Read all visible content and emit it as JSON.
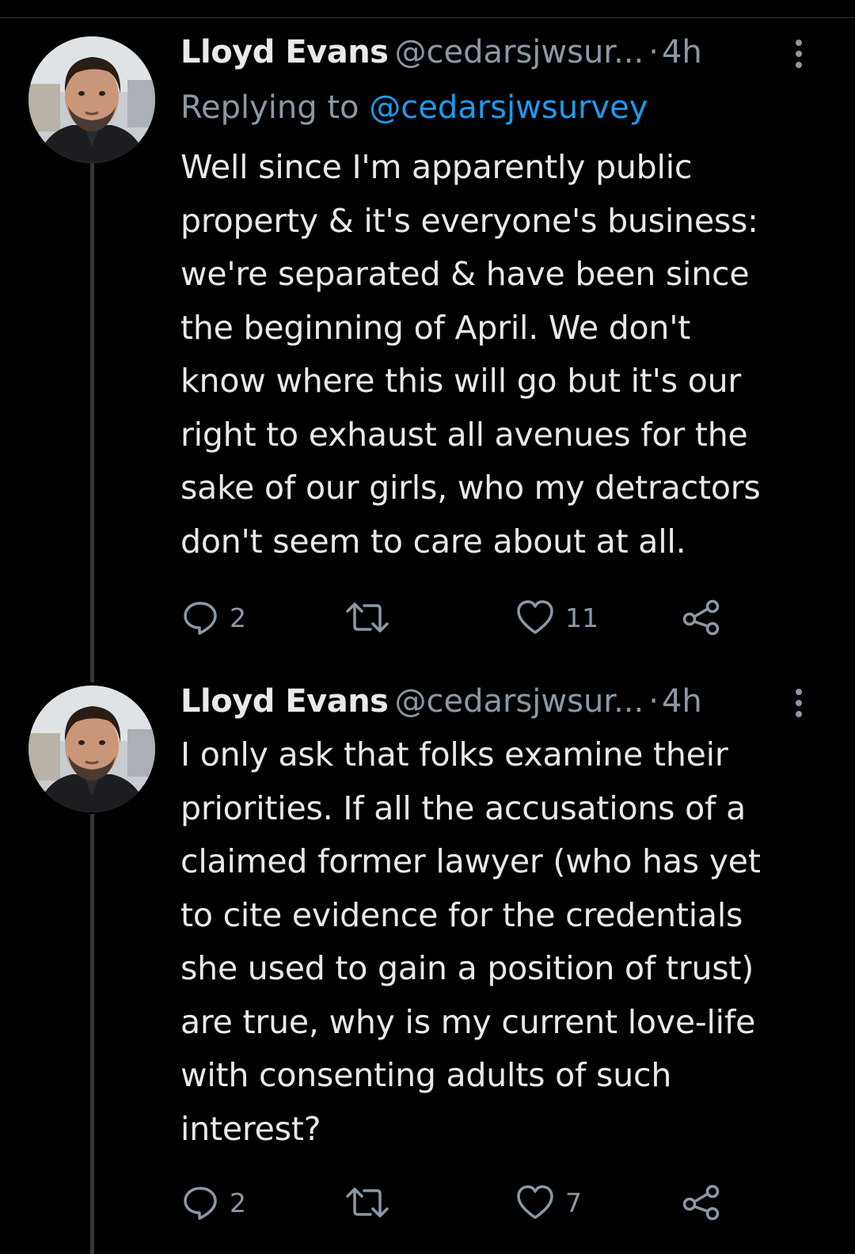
{
  "colors": {
    "background": "#000000",
    "text": "#e7e9ea",
    "muted": "#8b98a5",
    "link": "#1d9bf0",
    "thread_line": "#333639"
  },
  "tweets": [
    {
      "author_name": "Lloyd Evans",
      "author_handle": "@cedarsjwsur...",
      "separator": "·",
      "time": "4h",
      "replying_prefix": "Replying to ",
      "replying_to": "@cedarsjwsurvey",
      "lines": [
        "Well since I'm apparently public",
        "property & it's everyone's business:",
        "we're separated & have been since",
        "the beginning of April. We don't",
        "know where this will go but it's our",
        "right to exhaust all avenues for the",
        "sake of our girls, who my detractors",
        "don't seem to care about at all."
      ],
      "reply_count": "2",
      "retweet_count": "",
      "like_count": "11",
      "icons": [
        "avatar",
        "more-icon",
        "reply-icon",
        "retweet-icon",
        "like-icon",
        "share-icon"
      ]
    },
    {
      "author_name": "Lloyd Evans",
      "author_handle": "@cedarsjwsur...",
      "separator": "·",
      "time": "4h",
      "lines": [
        "I only ask that folks examine their",
        "priorities. If all the accusations of a",
        "claimed former lawyer (who has yet",
        "to cite evidence for the credentials",
        "she used to gain a position of trust)",
        "are true, why is my current love-life",
        "with consenting adults of such",
        "interest?"
      ],
      "reply_count": "2",
      "retweet_count": "",
      "like_count": "7",
      "icons": [
        "avatar",
        "more-icon",
        "reply-icon",
        "retweet-icon",
        "like-icon",
        "share-icon"
      ]
    }
  ]
}
